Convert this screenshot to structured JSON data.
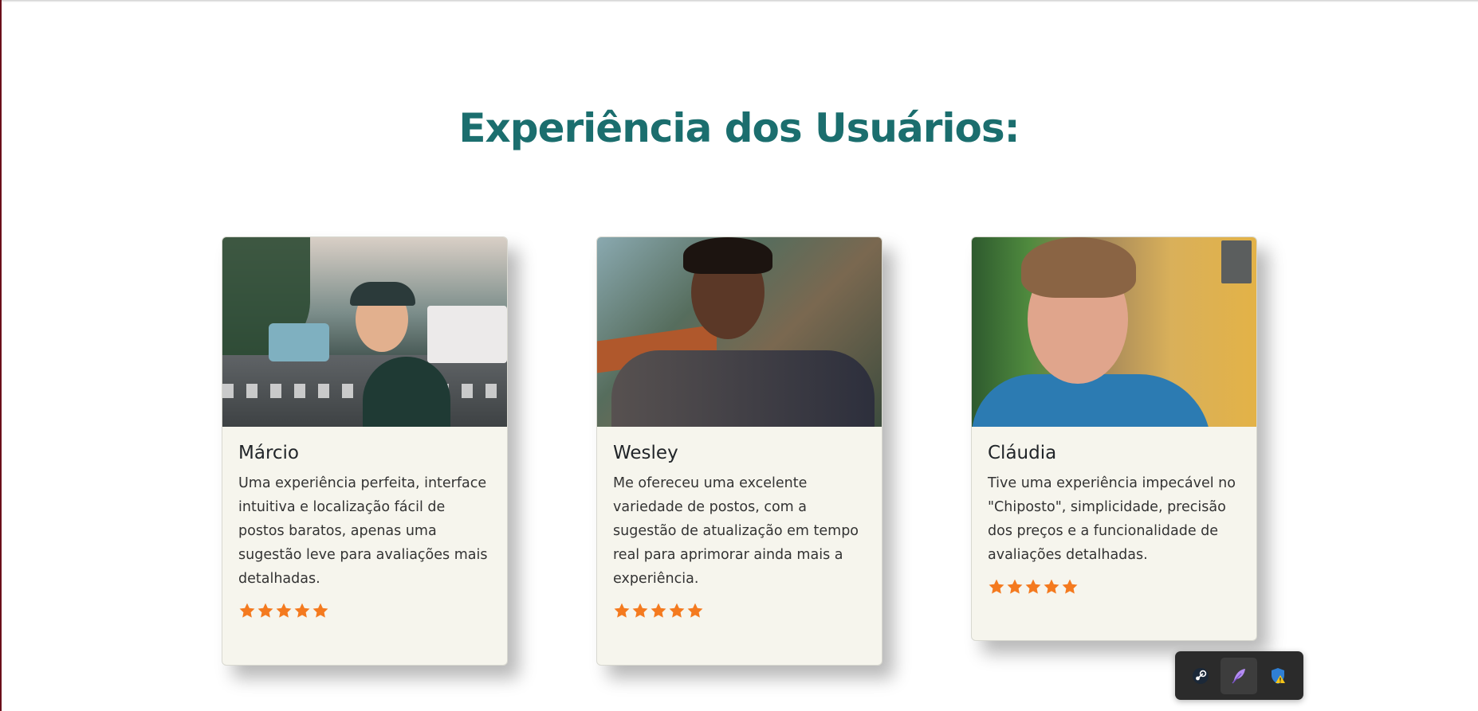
{
  "section": {
    "title": "Experiência dos Usuários:"
  },
  "colors": {
    "title": "#1b6e6e",
    "card_background": "#f6f5ed",
    "star": "#f47a1f",
    "tray_background": "#2b2b2b"
  },
  "testimonials": [
    {
      "name": "Márcio",
      "text": "Uma experiência perfeita, interface intuitiva e localização fácil de postos baratos, apenas uma sugestão leve para avaliações mais detalhadas.",
      "rating": 5
    },
    {
      "name": "Wesley",
      "text": "Me ofereceu uma excelente variedade de postos, com a sugestão de atualização em tempo real para aprimorar ainda mais a experiência.",
      "rating": 5
    },
    {
      "name": "Cláudia",
      "text": "Tive uma experiência impecável no \"Chiposto\", simplicidade, precisão dos preços e a funcionalidade de avaliações detalhadas.",
      "rating": 5
    }
  ],
  "tray": {
    "icons": [
      "steam-icon",
      "feather-icon",
      "shield-warning-icon"
    ]
  }
}
